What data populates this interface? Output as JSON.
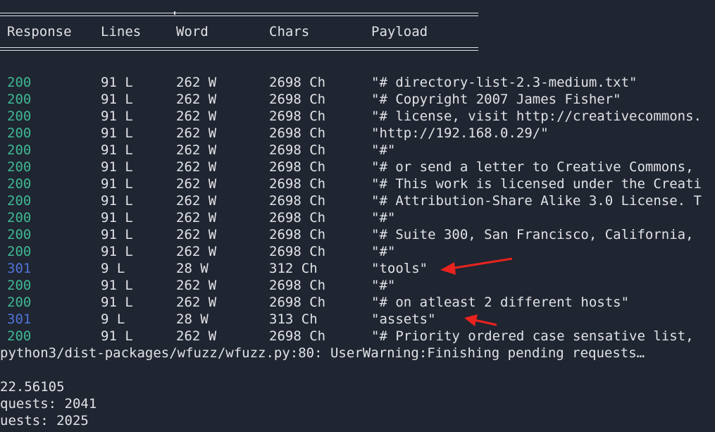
{
  "header": {
    "columns": [
      "Response",
      "Lines",
      "Word",
      "Chars",
      "Payload"
    ]
  },
  "rows": [
    {
      "code": "200",
      "lines": "91 L",
      "words": "262 W",
      "chars": "2698 Ch",
      "payload": "\"# directory-list-2.3-medium.txt\""
    },
    {
      "code": "200",
      "lines": "91 L",
      "words": "262 W",
      "chars": "2698 Ch",
      "payload": "\"# Copyright 2007 James Fisher\""
    },
    {
      "code": "200",
      "lines": "91 L",
      "words": "262 W",
      "chars": "2698 Ch",
      "payload": "\"# license, visit http://creativecommons."
    },
    {
      "code": "200",
      "lines": "91 L",
      "words": "262 W",
      "chars": "2698 Ch",
      "payload": "\"http://192.168.0.29/\""
    },
    {
      "code": "200",
      "lines": "91 L",
      "words": "262 W",
      "chars": "2698 Ch",
      "payload": "\"#\""
    },
    {
      "code": "200",
      "lines": "91 L",
      "words": "262 W",
      "chars": "2698 Ch",
      "payload": "\"# or send a letter to Creative Commons,"
    },
    {
      "code": "200",
      "lines": "91 L",
      "words": "262 W",
      "chars": "2698 Ch",
      "payload": "\"# This work is licensed under the Creati"
    },
    {
      "code": "200",
      "lines": "91 L",
      "words": "262 W",
      "chars": "2698 Ch",
      "payload": "\"# Attribution-Share Alike 3.0 License. T"
    },
    {
      "code": "200",
      "lines": "91 L",
      "words": "262 W",
      "chars": "2698 Ch",
      "payload": "\"#\""
    },
    {
      "code": "200",
      "lines": "91 L",
      "words": "262 W",
      "chars": "2698 Ch",
      "payload": "\"# Suite 300, San Francisco, California,"
    },
    {
      "code": "200",
      "lines": "91 L",
      "words": "262 W",
      "chars": "2698 Ch",
      "payload": "\"#\""
    },
    {
      "code": "301",
      "lines": "9 L",
      "words": "28 W",
      "chars": "312 Ch",
      "payload": "\"tools\""
    },
    {
      "code": "200",
      "lines": "91 L",
      "words": "262 W",
      "chars": "2698 Ch",
      "payload": "\"#\""
    },
    {
      "code": "200",
      "lines": "91 L",
      "words": "262 W",
      "chars": "2698 Ch",
      "payload": "\"# on atleast 2 different hosts\""
    },
    {
      "code": "301",
      "lines": "9 L",
      "words": "28 W",
      "chars": "313 Ch",
      "payload": "\"assets\""
    },
    {
      "code": "200",
      "lines": "91 L",
      "words": "262 W",
      "chars": "2698 Ch",
      "payload": "\"# Priority ordered case sensative list,"
    }
  ],
  "footer": {
    "warning": "python3/dist-packages/wfuzz/wfuzz.py:80: UserWarning:Finishing pending requests…",
    "time": "22.56105",
    "processed": "quests: 2041",
    "filtered": "uests: 2025"
  },
  "colors": {
    "background": "#1f2531",
    "text": "#e2e2e6",
    "status_200": "#3fb893",
    "status_301": "#4f74d9",
    "annotation_arrow": "#e8231f"
  },
  "annotations": [
    "red-arrow-tools",
    "red-arrow-assets"
  ]
}
